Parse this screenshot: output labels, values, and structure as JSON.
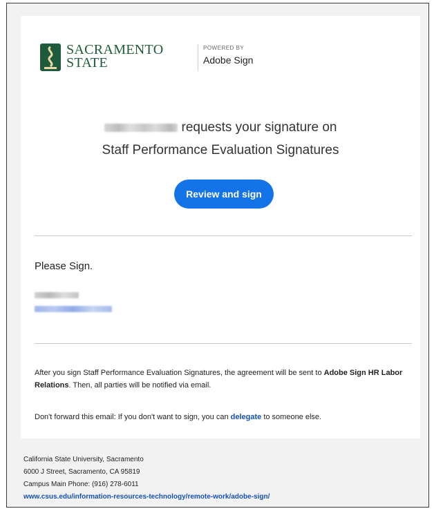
{
  "logo": {
    "line1": "SACRAMENTO",
    "line2": "STATE",
    "powered_by": "POWERED BY",
    "product": "Adobe Sign",
    "brand_color": "#1f5a3d"
  },
  "request": {
    "text": "requests your signature on",
    "agreement_title": "Staff Performance Evaluation Signatures"
  },
  "button": {
    "label": "Review and sign",
    "color": "#1473e6"
  },
  "message": "Please Sign.",
  "info": {
    "part1": "After you sign Staff Performance Evaluation Signatures, the agreement will be sent to ",
    "recipient": "Adobe Sign HR Labor Relations",
    "part2": ". Then, all parties will be notified via email."
  },
  "forward": {
    "part1": "Don't forward this email: If you don't want to sign, you can ",
    "link": "delegate",
    "part2": " to someone else."
  },
  "footer": {
    "org": "California State University, Sacramento",
    "address": "6000 J Street, Sacramento, CA 95819",
    "phone": "Campus Main Phone: (916) 278-6011",
    "url": "www.csus.edu/information-resources-technology/remote-work/adobe-sign/"
  }
}
